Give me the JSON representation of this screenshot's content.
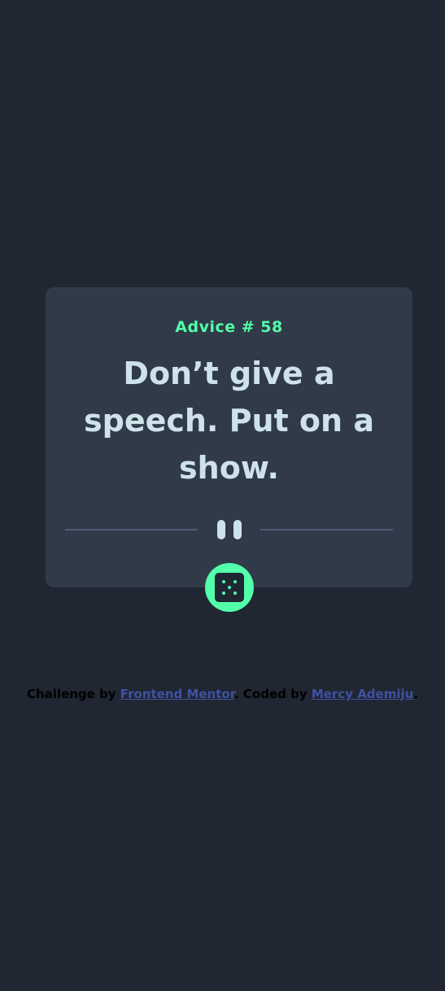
{
  "card": {
    "advice_label": "Advice # 58",
    "quote": "Don’t give a speech. Put on a show."
  },
  "dice_button": {
    "icon": "dice-icon",
    "aria_label": "Get new advice"
  },
  "attribution": {
    "prefix": "Challenge by ",
    "link1": "Frontend Mentor",
    "middle": ". Coded by ",
    "link2": "Mercy Ademiju",
    "suffix": "."
  },
  "colors": {
    "background": "#202632",
    "card": "#313A49",
    "accent_green": "#53FFAA",
    "text_light": "#CEE3E9",
    "divider": "#4F5D74",
    "link": "#3E52A3"
  }
}
